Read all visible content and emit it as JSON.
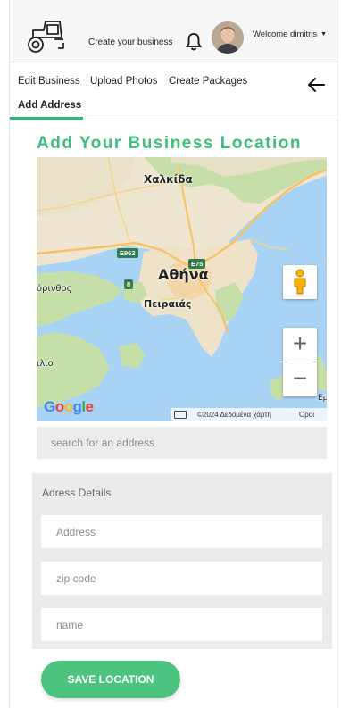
{
  "header": {
    "logo_icon": "tractor-icon",
    "create_business_label": "Create your business",
    "notifications_icon": "bell-icon",
    "welcome_label": "Welcome dimitris",
    "user_menu_icon": "caret-down-icon"
  },
  "tabs": {
    "items": [
      {
        "label": "Edit Business"
      },
      {
        "label": "Upload Photos"
      },
      {
        "label": "Create Packages"
      },
      {
        "label": "Add Address",
        "active": true
      }
    ],
    "back_icon": "arrow-left-icon",
    "accent_color": "#2fb872"
  },
  "page": {
    "title": "Add Your Business Location",
    "title_color": "#3fbf7a"
  },
  "map": {
    "labels": {
      "chalkida": "Χαλκίδα",
      "athens": "Αθήνα",
      "piraeus": "Πειραιάς",
      "korinthos": "όρινθος",
      "aigio": "ιλιο",
      "er": "Ερ"
    },
    "road_badges": {
      "e962": "E962",
      "e75": "E75",
      "r8": "8"
    },
    "zoom_in_label": "+",
    "zoom_out_label": "−",
    "pegman_icon": "pegman-icon",
    "keyboard_icon": "keyboard-icon",
    "google_logo": {
      "g1": "G",
      "o1": "o",
      "o2": "o",
      "g2": "g",
      "l": "l",
      "e": "e"
    },
    "attribution": "©2024 Δεδομένα χάρτη",
    "terms": "Όροι"
  },
  "search": {
    "placeholder": "search for an address",
    "value": ""
  },
  "details": {
    "title": "Adress Details",
    "address_placeholder": "Address",
    "zip_placeholder": "zip code",
    "name_placeholder": "name"
  },
  "actions": {
    "save_label": "SAVE LOCATION",
    "save_color": "#4cc47f"
  }
}
